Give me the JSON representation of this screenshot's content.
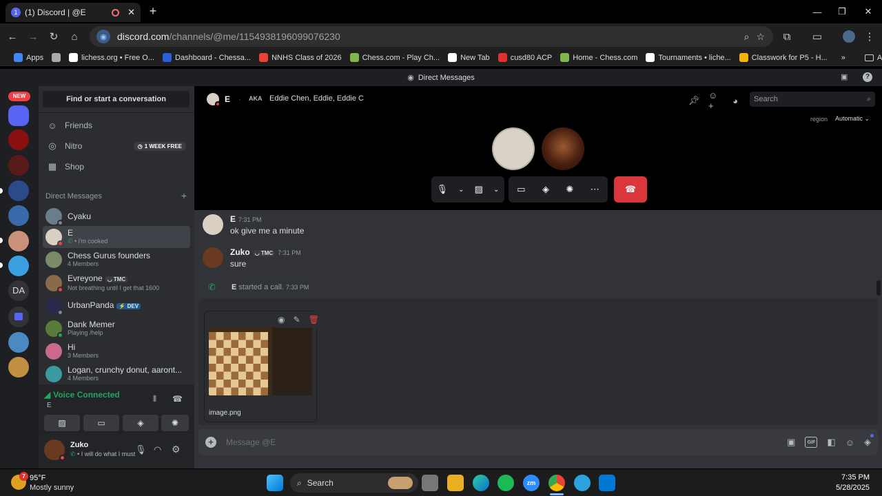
{
  "browser": {
    "tab_title": "(1) Discord | @E",
    "tab_favicon_text": "1",
    "new_tab": "+",
    "url_host": "discord.com",
    "url_path": "/channels/@me/1154938196099076230",
    "bookmarks": [
      {
        "label": "Apps",
        "color": "#4285f4"
      },
      {
        "label": "",
        "color": "#aaaaaa"
      },
      {
        "label": "lichess.org • Free O...",
        "color": "#ffffff"
      },
      {
        "label": "Dashboard - Chessa...",
        "color": "#2b5fd9"
      },
      {
        "label": "NNHS Class of 2026",
        "color": "#ea4335"
      },
      {
        "label": "Chess.com - Play Ch...",
        "color": "#81b64c"
      },
      {
        "label": "New Tab",
        "color": "#ffffff"
      },
      {
        "label": "cusd80 ACP",
        "color": "#e03030"
      },
      {
        "label": "Home - Chess.com",
        "color": "#81b64c"
      },
      {
        "label": "Tournaments • liche...",
        "color": "#ffffff"
      },
      {
        "label": "Classwork for P5 - H...",
        "color": "#f4b400"
      }
    ],
    "more_bookmarks": "»",
    "all_bookmarks": "All Bookmarks"
  },
  "discord": {
    "title": "Direct Messages",
    "new_badge": "NEW",
    "server_initials": "DA",
    "find": "Find or start a conversation",
    "nav": [
      {
        "label": "Friends",
        "icon": "friends-icon"
      },
      {
        "label": "Nitro",
        "icon": "nitro-icon"
      },
      {
        "label": "Shop",
        "icon": "shop-icon"
      }
    ],
    "nitro_badge": "1 WEEK FREE",
    "dm_header": "Direct Messages",
    "dm_add": "+",
    "dms": [
      {
        "name": "Cyaku",
        "sub": "",
        "tag": "",
        "color": "#6b7c8a",
        "status": "#80848e"
      },
      {
        "name": "E",
        "sub": "• i'm cooked",
        "tag": "",
        "color": "#d9cfc2",
        "status": "#f23f43"
      },
      {
        "name": "Chess Gurus founders",
        "sub": "4 Members",
        "tag": "",
        "color": "#7a8a6a",
        "status": ""
      },
      {
        "name": "Evreyone",
        "sub": "Not breathing until I get that 1600",
        "tag": "TMC",
        "color": "#8a6a4a",
        "status": "#f23f43"
      },
      {
        "name": "UrbanPanda",
        "sub": "",
        "tag": "DEV",
        "color": "#2a2a4a",
        "status": "#80848e"
      },
      {
        "name": "Dank Memer",
        "sub": "Playing /help",
        "tag": "",
        "color": "#5a7a3a",
        "status": "#23a55a"
      },
      {
        "name": "Hi",
        "sub": "3 Members",
        "tag": "",
        "color": "#c96a8a",
        "status": ""
      },
      {
        "name": "Logan, crunchy donut, aaront...",
        "sub": "4 Members",
        "tag": "",
        "color": "#3a9aa0",
        "status": ""
      }
    ],
    "voice_status": "Voice Connected",
    "voice_channel": "E",
    "user_name": "Zuko",
    "user_status": "• I will do what I must",
    "call_header": {
      "name": "E",
      "aka_label": "AKA",
      "aka": "Eddie Chen, Eddie, Eddie C",
      "search_placeholder": "Search",
      "region_label": "region",
      "region_value": "Automatic"
    },
    "messages": [
      {
        "author": "E",
        "time": "7:31 PM",
        "text": "ok give me a minute",
        "tag": ""
      },
      {
        "author": "Zuko",
        "time": "7:31 PM",
        "text": "sure",
        "tag": "TMC"
      }
    ],
    "system_message": {
      "author": "E",
      "text": "started a call.",
      "time": "7:33 PM"
    },
    "attachment": {
      "filename": "image.png"
    },
    "composer_placeholder": "Message @E",
    "composer_icons": [
      "gift-icon",
      "gif-icon",
      "sticker-icon",
      "emoji-icon",
      "activity-icon"
    ],
    "gif_label": "GIF"
  },
  "taskbar": {
    "weather_temp": "95°F",
    "weather_desc": "Mostly sunny",
    "weather_badge": "7",
    "search": "Search",
    "time": "7:35 PM",
    "date": "5/28/2025"
  },
  "colors": {
    "discord_blurple": "#5865f2",
    "danger": "#da373c",
    "online": "#23a55a"
  }
}
